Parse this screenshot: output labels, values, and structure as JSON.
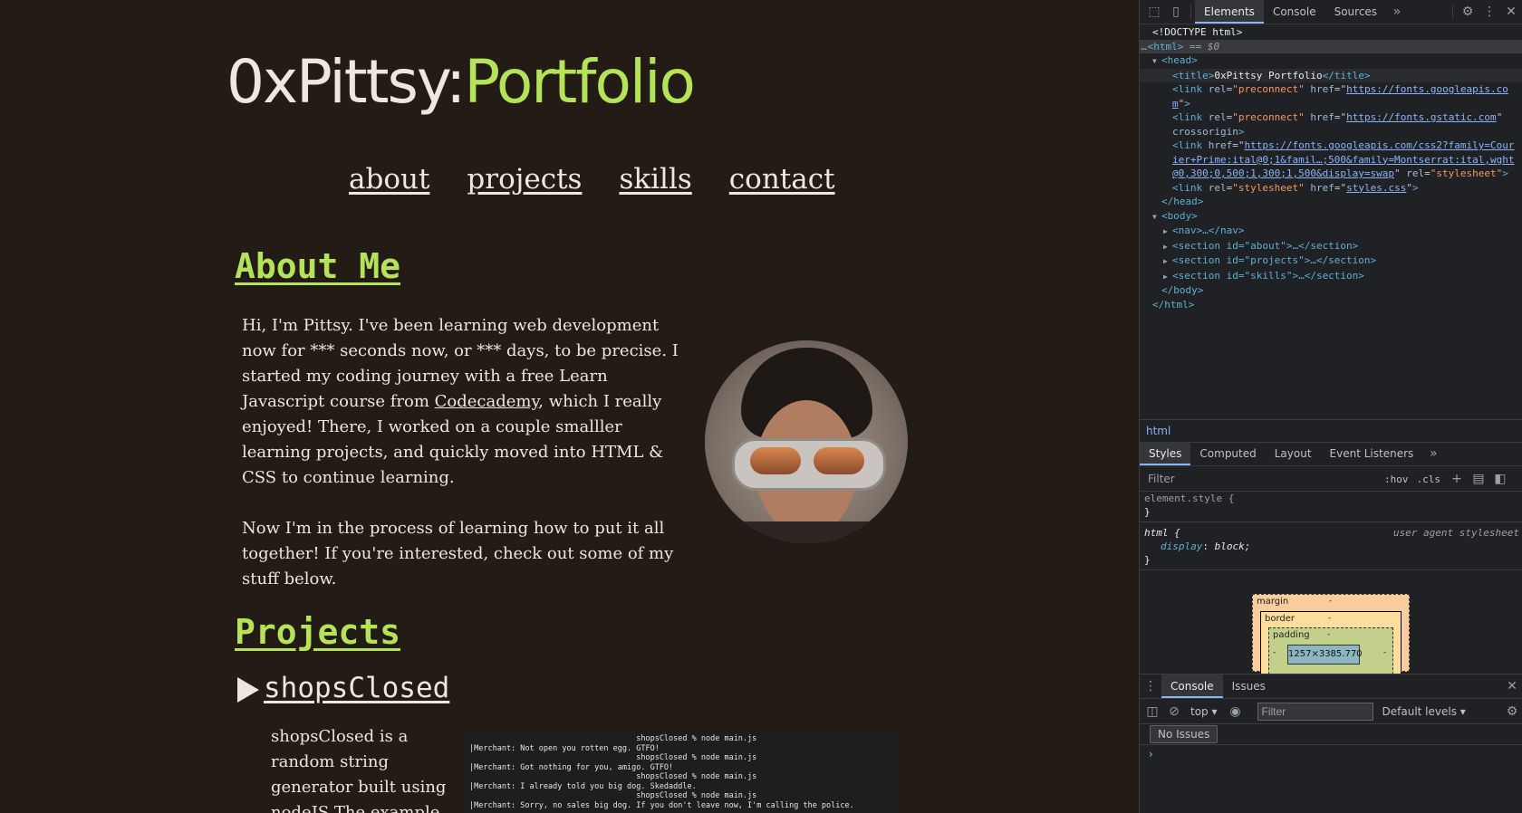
{
  "site": {
    "title_part1": "0xPittsy:",
    "title_part2": "Portfolio",
    "nav": [
      "about",
      "projects",
      "skills",
      "contact"
    ],
    "about": {
      "heading": "About Me",
      "p1_a": "Hi, I'm Pittsy. I've been learning web development now for *** seconds now, or *** days, to be precise. I started my coding journey with a free Learn Javascript course from ",
      "p1_link": "Codecademy",
      "p1_b": ", which I really enjoyed! There, I worked on a couple smalller learning projects, and quickly moved into HTML & CSS to continue learning.",
      "p2": "Now I'm in the process of learning how to put it all together! If you're interested, check out some of my stuff below."
    },
    "projects": {
      "heading": "Projects",
      "item_title": "shopsClosed",
      "item_desc": "shopsClosed is a random string generator built using nodeJS The example provided uses",
      "terminal_lines": [
        "                                    shopsClosed % node main.js",
        "|Merchant: Not open you rotten egg. GTFO!",
        "                                    shopsClosed % node main.js",
        "|Merchant: Got nothing for you, amigo. GTFO!",
        "                                    shopsClosed % node main.js",
        "|Merchant: I already told you big dog. Skedaddle.",
        "                                    shopsClosed % node main.js",
        "|Merchant: Sorry, no sales big dog. If you don't leave now, I'm calling the police."
      ]
    }
  },
  "devtools": {
    "tabs": [
      "Elements",
      "Console",
      "Sources"
    ],
    "more": "»",
    "dom": {
      "doctype": "<!DOCTYPE html>",
      "html_open": "<html>",
      "html_eq": "== $0",
      "head_open": "<head>",
      "title_open": "<title>",
      "title_text": "0xPittsy Portfolio",
      "title_close": "</title>",
      "link_tag": "<link",
      "rel_attr": "rel",
      "href_attr": "href",
      "crossorigin": "crossorigin",
      "preconnect": "\"preconnect\"",
      "href1": "https://fonts.googleapis.com",
      "href2": "https://fonts.gstatic.com",
      "href3": "https://fonts.googleapis.com/css2?family=Courier+Prime:ital@0;1&famil…;500&family=Montserrat:ital,wght@0,300;0,500;1,300;1,500&display=swap",
      "stylesheet": "\"stylesheet\"",
      "href4": "styles.css",
      "head_close": "</head>",
      "body_open": "<body>",
      "nav": "<nav>…</nav>",
      "section_about": "<section id=\"about\">…</section>",
      "section_projects": "<section id=\"projects\">…</section>",
      "section_skills": "<section id=\"skills\">…</section>",
      "body_close": "</body>",
      "html_close": "</html>"
    },
    "breadcrumb": "html",
    "styles_tabs": [
      "Styles",
      "Computed",
      "Layout",
      "Event Listeners"
    ],
    "filter_placeholder": "Filter",
    "hov": ":hov",
    "cls": ".cls",
    "rule1_selector": "element.style {",
    "rule_close": "}",
    "rule2_selector": "html {",
    "rule2_origin": "user agent stylesheet",
    "rule2_prop": "display",
    "rule2_value": "block;",
    "boxmodel": {
      "margin": "margin",
      "border": "border",
      "padding": "padding",
      "content": "1257×3385.770",
      "dash": "-"
    },
    "drawer_tabs": [
      "Console",
      "Issues"
    ],
    "context": "top ▾",
    "console_filter": "Filter",
    "levels": "Default levels ▾",
    "issues": "No Issues",
    "prompt": "›",
    "colors": {
      "accent": "#8ab4f8",
      "site_green": "#b4e35a",
      "site_bg": "#231b15"
    }
  }
}
